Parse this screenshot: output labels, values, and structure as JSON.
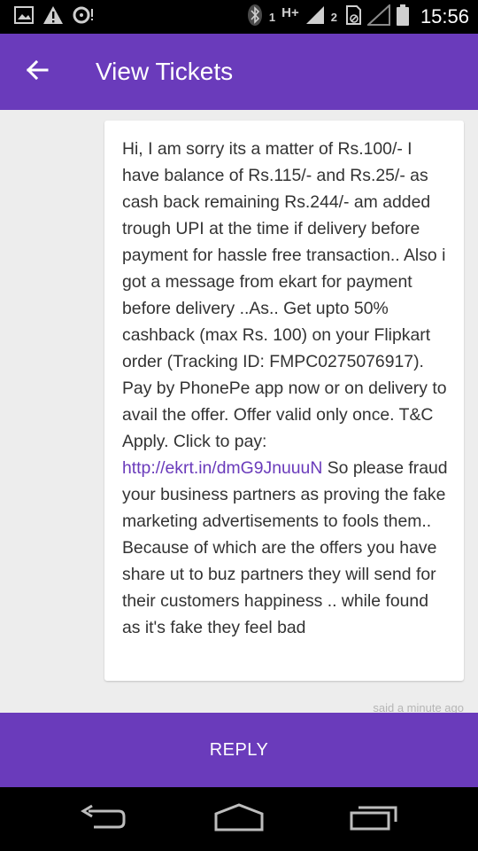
{
  "status_bar": {
    "sim1": "1",
    "network": "H+",
    "sim2": "2",
    "time": "15:56"
  },
  "app_bar": {
    "title": "View Tickets"
  },
  "message": {
    "text_before_link": "Hi, I am sorry its a matter of Rs.100/- I have balance of Rs.115/- and Rs.25/- as cash back remaining Rs.244/- am added trough UPI at the time if delivery before payment for hassle free transaction.. Also i got a message from ekart for payment before delivery ..As.. Get upto 50% cashback (max Rs. 100) on your Flipkart order (Tracking ID: FMPC0275076917). Pay by PhonePe app now or on delivery to avail the offer. Offer valid only once. T&C Apply. Click to pay: ",
    "link": "http://ekrt.in/dmG9JnuuuN",
    "text_after_link": " So please fraud your business partners as proving the fake marketing advertisements to fools them.. Because of which are the offers you have share ut to buz partners they will send for their customers happiness .. while found as it's fake they feel bad",
    "timestamp": "said a minute ago"
  },
  "reply": {
    "label": "REPLY"
  },
  "colors": {
    "brand": "#6a3bbb",
    "link": "#6a3bbb"
  }
}
